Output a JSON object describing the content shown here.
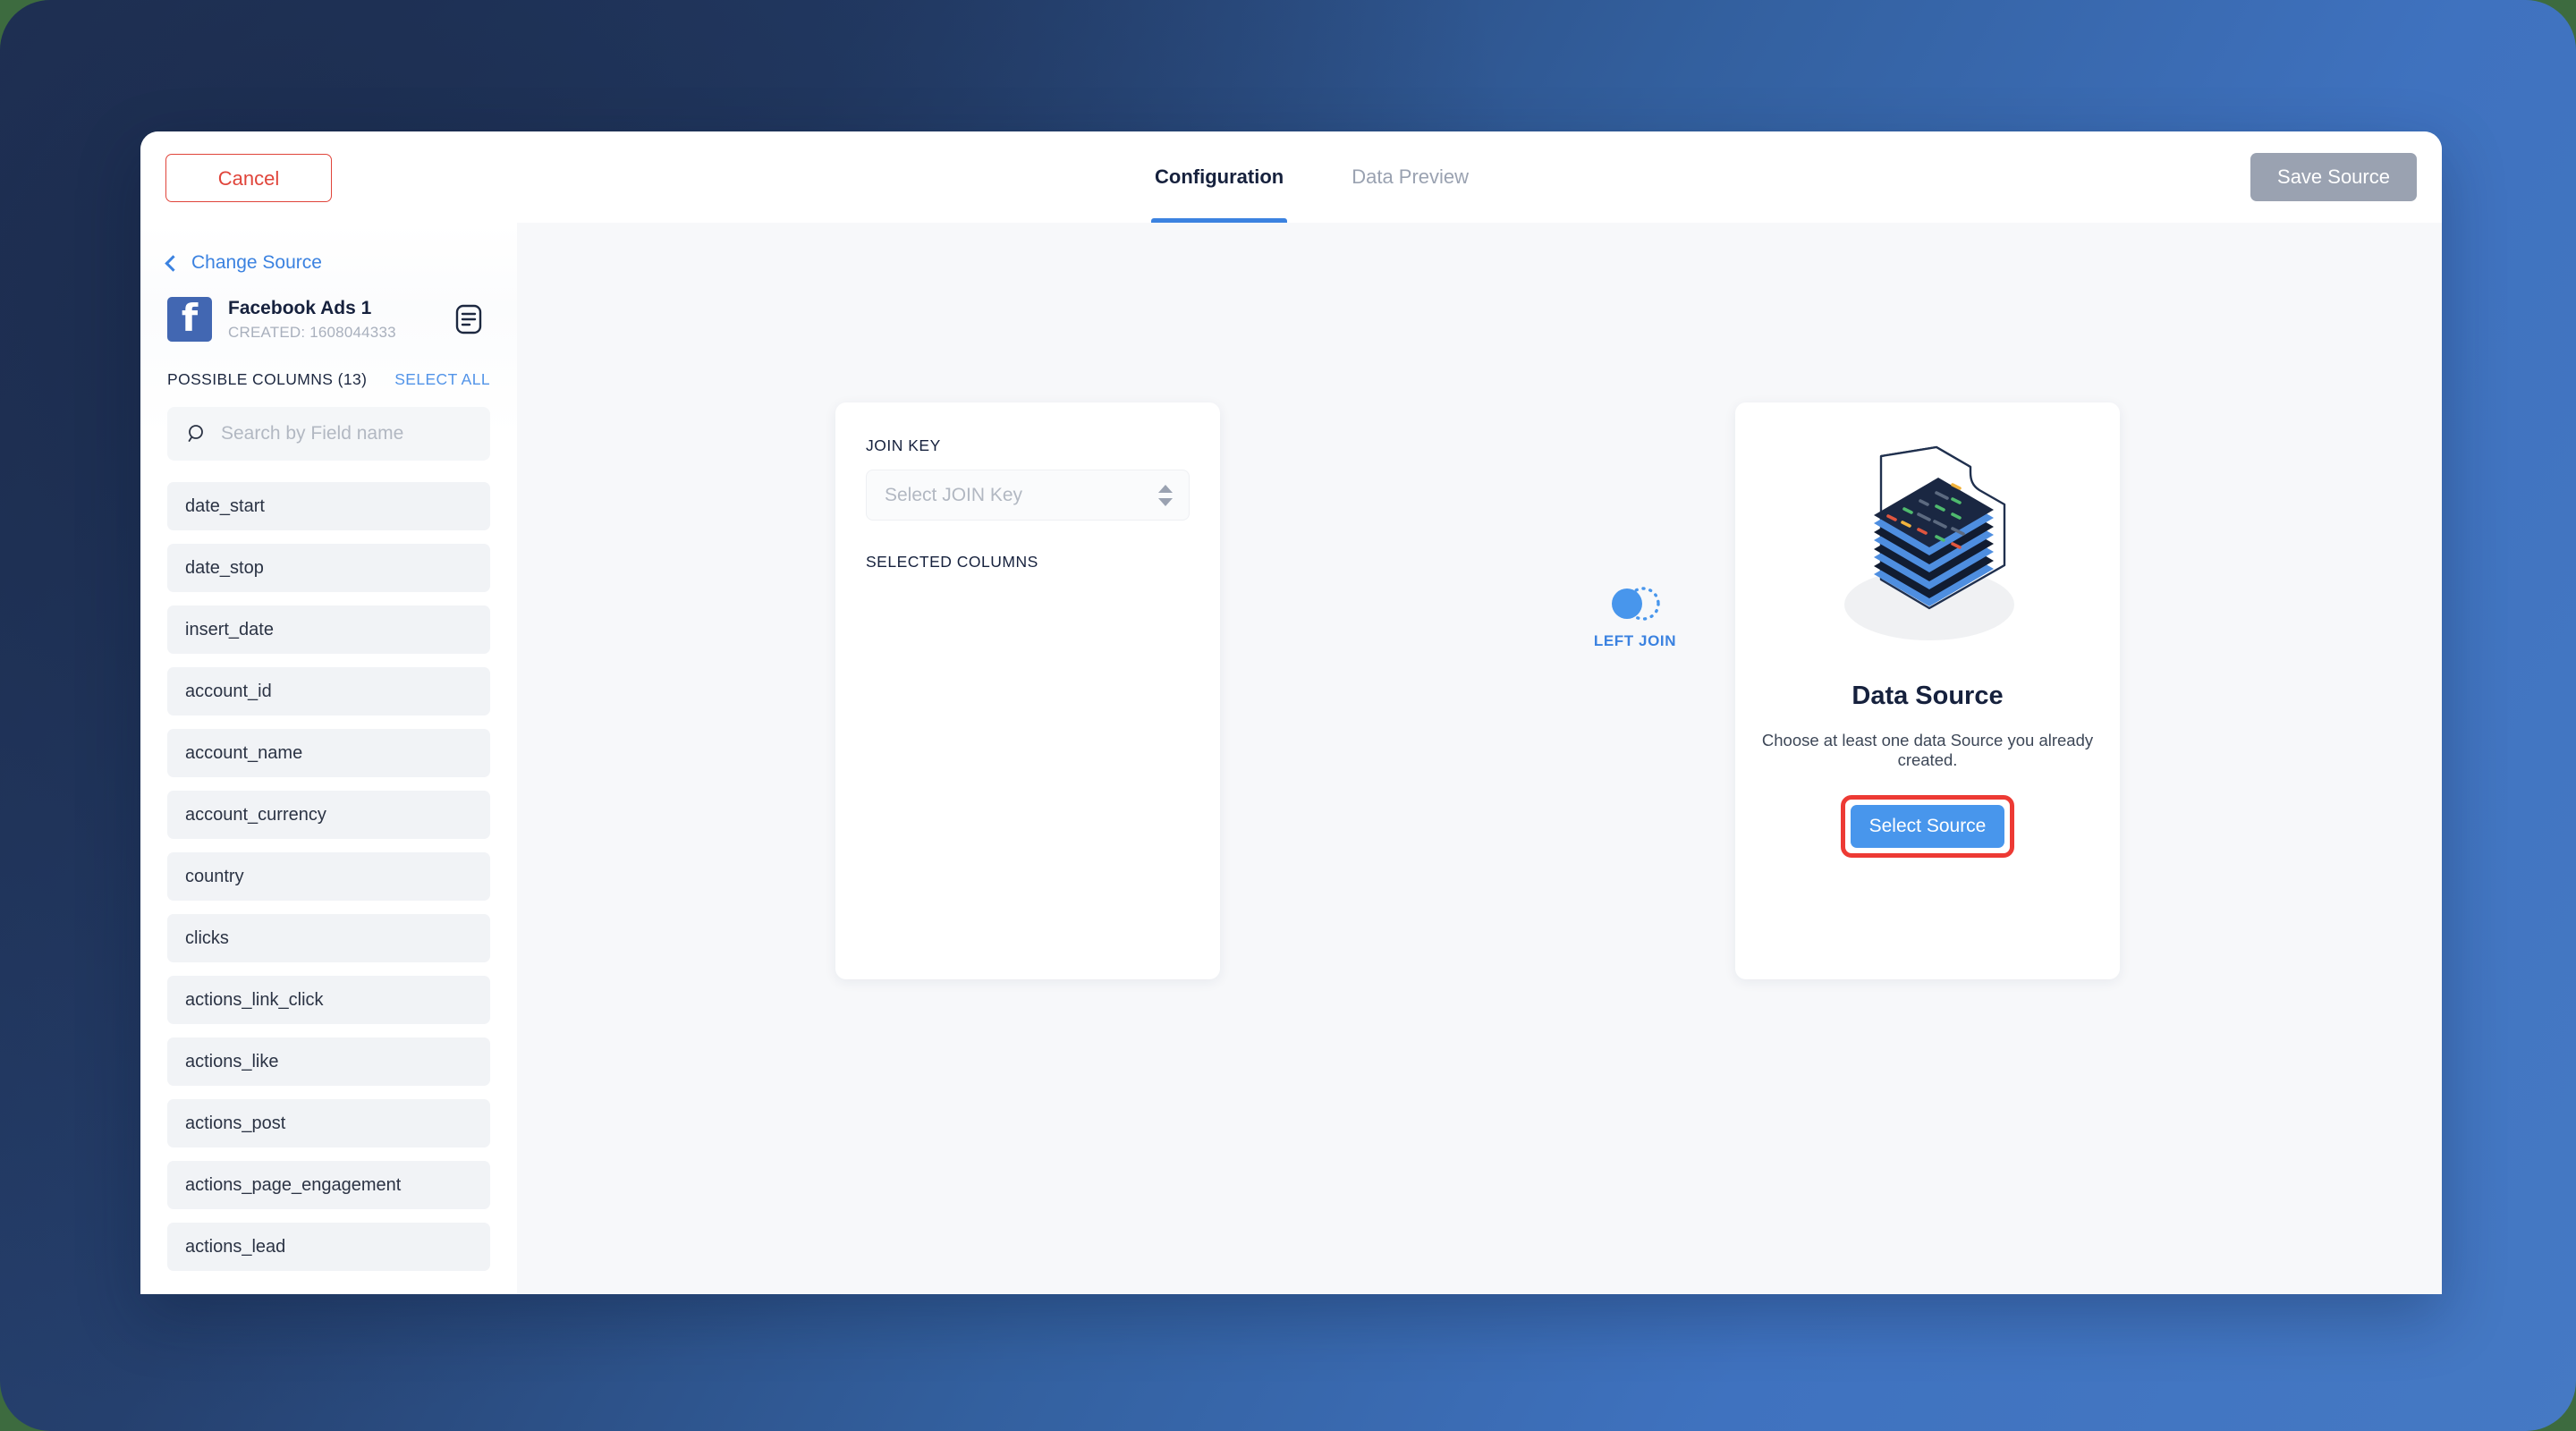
{
  "topbar": {
    "cancel_label": "Cancel",
    "save_label": "Save Source",
    "tabs": [
      {
        "label": "Configuration",
        "active": true
      },
      {
        "label": "Data Preview",
        "active": false
      }
    ]
  },
  "sidebar": {
    "change_source_label": "Change Source",
    "back_icon": "chevron-left-icon",
    "source": {
      "logo_icon": "facebook-logo-icon",
      "title": "Facebook Ads 1",
      "created_label": "CREATED: 1608044333",
      "notes_icon": "document-lines-icon"
    },
    "possible_columns_label": "POSSIBLE COLUMNS (13)",
    "select_all_label": "SELECT ALL",
    "search": {
      "icon": "search-icon",
      "value": "",
      "placeholder": "Search by Field name"
    },
    "columns": [
      "date_start",
      "date_stop",
      "insert_date",
      "account_id",
      "account_name",
      "account_currency",
      "country",
      "clicks",
      "actions_link_click",
      "actions_like",
      "actions_post",
      "actions_page_engagement",
      "actions_lead"
    ]
  },
  "canvas": {
    "join_card": {
      "join_key_label": "JOIN KEY",
      "join_key_value": "Select JOIN Key",
      "join_key_icon": "chevron-updown-icon",
      "selected_columns_label": "SELECTED COLUMNS"
    },
    "join_badge": {
      "icon": "left-join-venn-icon",
      "label": "LEFT JOIN"
    },
    "source_card": {
      "illustration_icon": "data-stack-folder-illustration",
      "title": "Data Source",
      "subtitle": "Choose at least one data Source you already created.",
      "button_label": "Select Source"
    }
  },
  "colors": {
    "accent_blue": "#3b82e0",
    "button_blue": "#4896ec",
    "danger_red": "#e0443a",
    "highlight_red": "#ed3a34",
    "disabled_gray": "#9aa2b1",
    "facebook_blue": "#4267b2",
    "navy": "#16213d"
  }
}
